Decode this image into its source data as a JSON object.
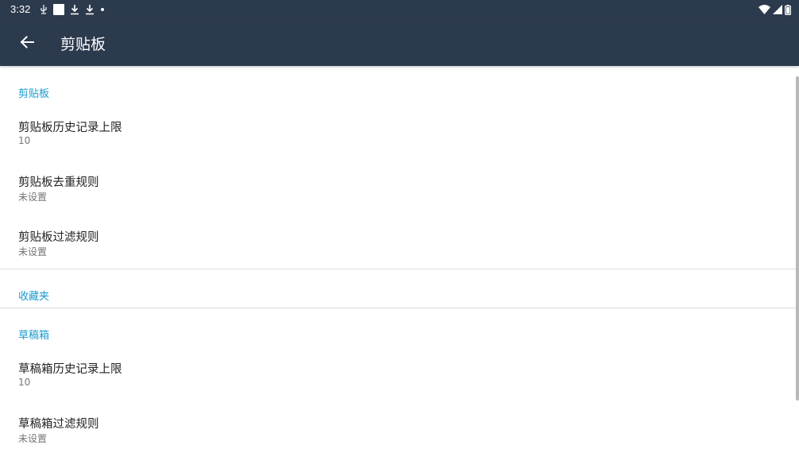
{
  "status_bar": {
    "time": "3:32"
  },
  "app_bar": {
    "title": "剪贴板",
    "back_icon": "arrow-back-icon"
  },
  "sections": [
    {
      "header": "剪贴板",
      "items": [
        {
          "title": "剪贴板历史记录上限",
          "summary": "10"
        },
        {
          "title": "剪贴板去重规则",
          "summary": "未设置"
        },
        {
          "title": "剪贴板过滤规则",
          "summary": "未设置"
        }
      ]
    },
    {
      "header": "收藏夹",
      "items": []
    },
    {
      "header": "草稿箱",
      "items": [
        {
          "title": "草稿箱历史记录上限",
          "summary": "10"
        },
        {
          "title": "草稿箱过滤规则",
          "summary": "未设置"
        }
      ]
    }
  ],
  "colors": {
    "toolbar": "#2c3a4d",
    "accent": "#1a9bd0",
    "title_text": "#212121",
    "summary_text": "#757575"
  }
}
